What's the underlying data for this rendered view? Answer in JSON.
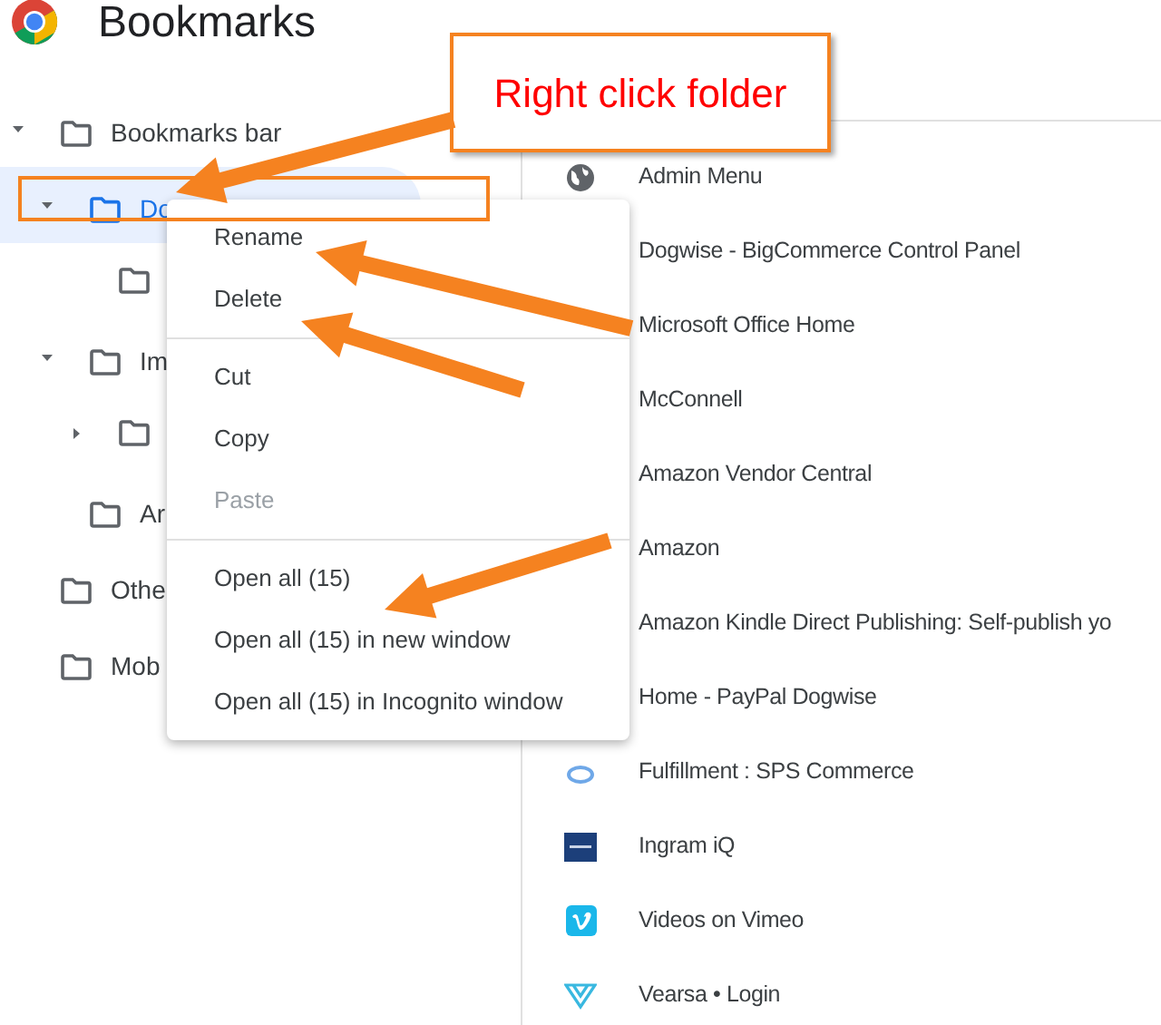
{
  "header": {
    "title": "Bookmarks"
  },
  "tree": [
    {
      "label": "Bookmarks bar",
      "expanded": true,
      "selected": false,
      "children": [
        {
          "label": "Do",
          "expanded": true,
          "selected": true,
          "children": [
            {
              "selected": false
            }
          ]
        },
        {
          "label": "Im",
          "expanded": true,
          "selected": false,
          "children": [
            {
              "expanded": false,
              "selected": false
            }
          ]
        },
        {
          "label": "Ar",
          "selected": false
        }
      ]
    },
    {
      "label": "Othe",
      "selected": false
    },
    {
      "label": "Mob",
      "selected": false
    }
  ],
  "bookmarks": [
    {
      "title": "Admin Menu",
      "kind": "globe"
    },
    {
      "title": "Dogwise - BigCommerce Control Panel"
    },
    {
      "title": "Microsoft Office Home"
    },
    {
      "title": "McConnell"
    },
    {
      "title": "Amazon Vendor Central"
    },
    {
      "title": "Amazon"
    },
    {
      "title": "Amazon Kindle Direct Publishing: Self-publish yo"
    },
    {
      "title": "Home - PayPal Dogwise"
    },
    {
      "title": "Fulfillment : SPS Commerce",
      "kind": "ring"
    },
    {
      "title": "Ingram iQ",
      "kind": "bar"
    },
    {
      "title": "Videos on Vimeo",
      "kind": "video"
    },
    {
      "title": "Vearsa • Login",
      "kind": "triangle"
    }
  ],
  "context_menu": [
    {
      "kind": "item",
      "label": "Rename",
      "disabled": false
    },
    {
      "kind": "item",
      "label": "Delete",
      "disabled": false
    },
    {
      "kind": "divider"
    },
    {
      "kind": "item",
      "label": "Cut",
      "disabled": false
    },
    {
      "kind": "item",
      "label": "Copy",
      "disabled": false
    },
    {
      "kind": "item",
      "label": "Paste",
      "disabled": true
    },
    {
      "kind": "divider"
    },
    {
      "kind": "item",
      "label": "Open all (15)",
      "disabled": false
    },
    {
      "kind": "item",
      "label": "Open all (15) in new window",
      "disabled": false
    },
    {
      "kind": "item",
      "label": "Open all (15) in Incognito window",
      "disabled": false
    }
  ],
  "callout": {
    "text": "Right click folder"
  }
}
